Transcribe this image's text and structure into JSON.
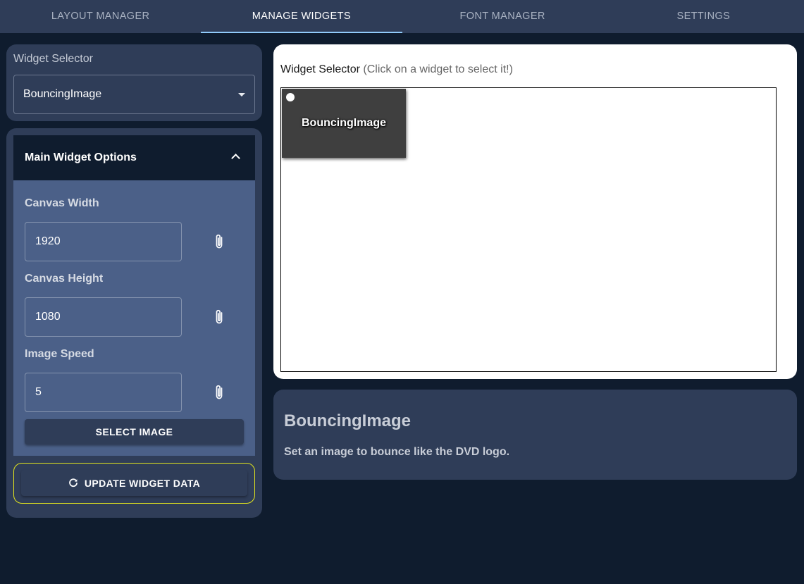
{
  "nav": {
    "tabs": [
      {
        "label": "LAYOUT MANAGER"
      },
      {
        "label": "MANAGE WIDGETS"
      },
      {
        "label": "FONT MANAGER"
      },
      {
        "label": "SETTINGS"
      }
    ],
    "active_tab": "MANAGE WIDGETS"
  },
  "selector": {
    "label": "Widget Selector",
    "value": "BouncingImage",
    "icon": "caret-down-icon"
  },
  "options": {
    "title": "Main Widget Options",
    "expanded": true,
    "fields": [
      {
        "label": "Canvas Width",
        "value": "1920",
        "icon": "paperclip-icon"
      },
      {
        "label": "Canvas Height",
        "value": "1080",
        "icon": "paperclip-icon"
      },
      {
        "label": "Image Speed",
        "value": "5",
        "icon": "paperclip-icon"
      }
    ],
    "select_image_label": "SELECT IMAGE",
    "update_label": "UPDATE WIDGET DATA",
    "update_icon": "refresh-icon"
  },
  "canvas": {
    "heading": "Widget Selector",
    "hint": "(Click on a widget to select it!)",
    "widget_label": "BouncingImage"
  },
  "info": {
    "title": "BouncingImage",
    "description": "Set an image to bounce like the DVD logo."
  },
  "colors": {
    "page_bg": "#0f1c2e",
    "card_bg": "#2f3d58",
    "accordion_body": "#4b6088",
    "active_tab_indicator": "#90caf9",
    "update_outline": "#e3e61e"
  }
}
